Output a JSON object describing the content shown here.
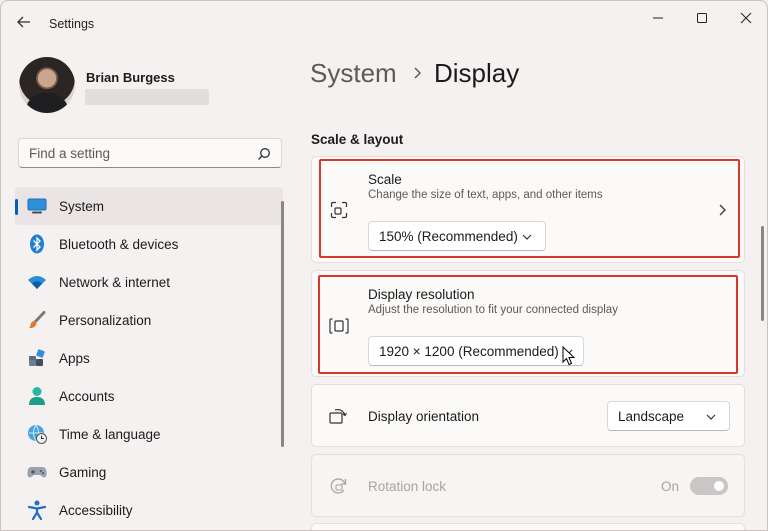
{
  "window": {
    "title": "Settings"
  },
  "profile": {
    "name": "Brian Burgess"
  },
  "search": {
    "placeholder": "Find a setting"
  },
  "sidebar": {
    "items": [
      {
        "label": "System",
        "icon": "system-icon",
        "active": true
      },
      {
        "label": "Bluetooth & devices",
        "icon": "bluetooth-icon"
      },
      {
        "label": "Network & internet",
        "icon": "wifi-icon"
      },
      {
        "label": "Personalization",
        "icon": "brush-icon"
      },
      {
        "label": "Apps",
        "icon": "apps-icon"
      },
      {
        "label": "Accounts",
        "icon": "account-icon"
      },
      {
        "label": "Time & language",
        "icon": "globe-clock-icon"
      },
      {
        "label": "Gaming",
        "icon": "controller-icon"
      },
      {
        "label": "Accessibility",
        "icon": "accessibility-icon"
      }
    ]
  },
  "breadcrumb": {
    "parent": "System",
    "current": "Display"
  },
  "main": {
    "section_title": "Scale & layout",
    "scale": {
      "title": "Scale",
      "description": "Change the size of text, apps, and other items",
      "value": "150% (Recommended)"
    },
    "resolution": {
      "title": "Display resolution",
      "description": "Adjust the resolution to fit your connected display",
      "value": "1920 × 1200 (Recommended)"
    },
    "orientation": {
      "title": "Display orientation",
      "value": "Landscape"
    },
    "rotation_lock": {
      "title": "Rotation lock",
      "state_label": "On",
      "enabled": false
    }
  },
  "colors": {
    "accent": "#005fb8",
    "highlight_border": "#d7392b",
    "window_bg": "#f5f1f0",
    "card_bg": "#fbfaf9"
  }
}
